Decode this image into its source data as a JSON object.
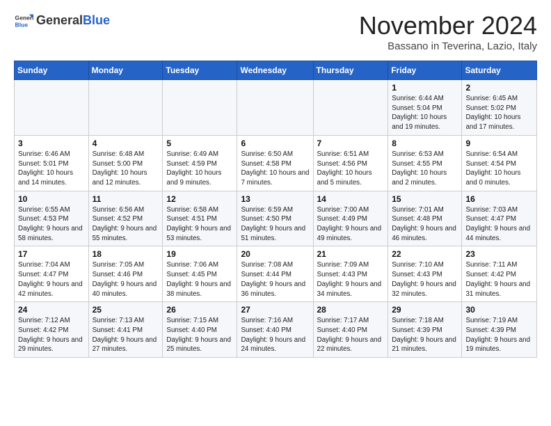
{
  "logo": {
    "general": "General",
    "blue": "Blue"
  },
  "header": {
    "month_year": "November 2024",
    "location": "Bassano in Teverina, Lazio, Italy"
  },
  "weekdays": [
    "Sunday",
    "Monday",
    "Tuesday",
    "Wednesday",
    "Thursday",
    "Friday",
    "Saturday"
  ],
  "weeks": [
    [
      {
        "day": "",
        "info": ""
      },
      {
        "day": "",
        "info": ""
      },
      {
        "day": "",
        "info": ""
      },
      {
        "day": "",
        "info": ""
      },
      {
        "day": "",
        "info": ""
      },
      {
        "day": "1",
        "info": "Sunrise: 6:44 AM\nSunset: 5:04 PM\nDaylight: 10 hours and 19 minutes."
      },
      {
        "day": "2",
        "info": "Sunrise: 6:45 AM\nSunset: 5:02 PM\nDaylight: 10 hours and 17 minutes."
      }
    ],
    [
      {
        "day": "3",
        "info": "Sunrise: 6:46 AM\nSunset: 5:01 PM\nDaylight: 10 hours and 14 minutes."
      },
      {
        "day": "4",
        "info": "Sunrise: 6:48 AM\nSunset: 5:00 PM\nDaylight: 10 hours and 12 minutes."
      },
      {
        "day": "5",
        "info": "Sunrise: 6:49 AM\nSunset: 4:59 PM\nDaylight: 10 hours and 9 minutes."
      },
      {
        "day": "6",
        "info": "Sunrise: 6:50 AM\nSunset: 4:58 PM\nDaylight: 10 hours and 7 minutes."
      },
      {
        "day": "7",
        "info": "Sunrise: 6:51 AM\nSunset: 4:56 PM\nDaylight: 10 hours and 5 minutes."
      },
      {
        "day": "8",
        "info": "Sunrise: 6:53 AM\nSunset: 4:55 PM\nDaylight: 10 hours and 2 minutes."
      },
      {
        "day": "9",
        "info": "Sunrise: 6:54 AM\nSunset: 4:54 PM\nDaylight: 10 hours and 0 minutes."
      }
    ],
    [
      {
        "day": "10",
        "info": "Sunrise: 6:55 AM\nSunset: 4:53 PM\nDaylight: 9 hours and 58 minutes."
      },
      {
        "day": "11",
        "info": "Sunrise: 6:56 AM\nSunset: 4:52 PM\nDaylight: 9 hours and 55 minutes."
      },
      {
        "day": "12",
        "info": "Sunrise: 6:58 AM\nSunset: 4:51 PM\nDaylight: 9 hours and 53 minutes."
      },
      {
        "day": "13",
        "info": "Sunrise: 6:59 AM\nSunset: 4:50 PM\nDaylight: 9 hours and 51 minutes."
      },
      {
        "day": "14",
        "info": "Sunrise: 7:00 AM\nSunset: 4:49 PM\nDaylight: 9 hours and 49 minutes."
      },
      {
        "day": "15",
        "info": "Sunrise: 7:01 AM\nSunset: 4:48 PM\nDaylight: 9 hours and 46 minutes."
      },
      {
        "day": "16",
        "info": "Sunrise: 7:03 AM\nSunset: 4:47 PM\nDaylight: 9 hours and 44 minutes."
      }
    ],
    [
      {
        "day": "17",
        "info": "Sunrise: 7:04 AM\nSunset: 4:47 PM\nDaylight: 9 hours and 42 minutes."
      },
      {
        "day": "18",
        "info": "Sunrise: 7:05 AM\nSunset: 4:46 PM\nDaylight: 9 hours and 40 minutes."
      },
      {
        "day": "19",
        "info": "Sunrise: 7:06 AM\nSunset: 4:45 PM\nDaylight: 9 hours and 38 minutes."
      },
      {
        "day": "20",
        "info": "Sunrise: 7:08 AM\nSunset: 4:44 PM\nDaylight: 9 hours and 36 minutes."
      },
      {
        "day": "21",
        "info": "Sunrise: 7:09 AM\nSunset: 4:43 PM\nDaylight: 9 hours and 34 minutes."
      },
      {
        "day": "22",
        "info": "Sunrise: 7:10 AM\nSunset: 4:43 PM\nDaylight: 9 hours and 32 minutes."
      },
      {
        "day": "23",
        "info": "Sunrise: 7:11 AM\nSunset: 4:42 PM\nDaylight: 9 hours and 31 minutes."
      }
    ],
    [
      {
        "day": "24",
        "info": "Sunrise: 7:12 AM\nSunset: 4:42 PM\nDaylight: 9 hours and 29 minutes."
      },
      {
        "day": "25",
        "info": "Sunrise: 7:13 AM\nSunset: 4:41 PM\nDaylight: 9 hours and 27 minutes."
      },
      {
        "day": "26",
        "info": "Sunrise: 7:15 AM\nSunset: 4:40 PM\nDaylight: 9 hours and 25 minutes."
      },
      {
        "day": "27",
        "info": "Sunrise: 7:16 AM\nSunset: 4:40 PM\nDaylight: 9 hours and 24 minutes."
      },
      {
        "day": "28",
        "info": "Sunrise: 7:17 AM\nSunset: 4:40 PM\nDaylight: 9 hours and 22 minutes."
      },
      {
        "day": "29",
        "info": "Sunrise: 7:18 AM\nSunset: 4:39 PM\nDaylight: 9 hours and 21 minutes."
      },
      {
        "day": "30",
        "info": "Sunrise: 7:19 AM\nSunset: 4:39 PM\nDaylight: 9 hours and 19 minutes."
      }
    ]
  ]
}
